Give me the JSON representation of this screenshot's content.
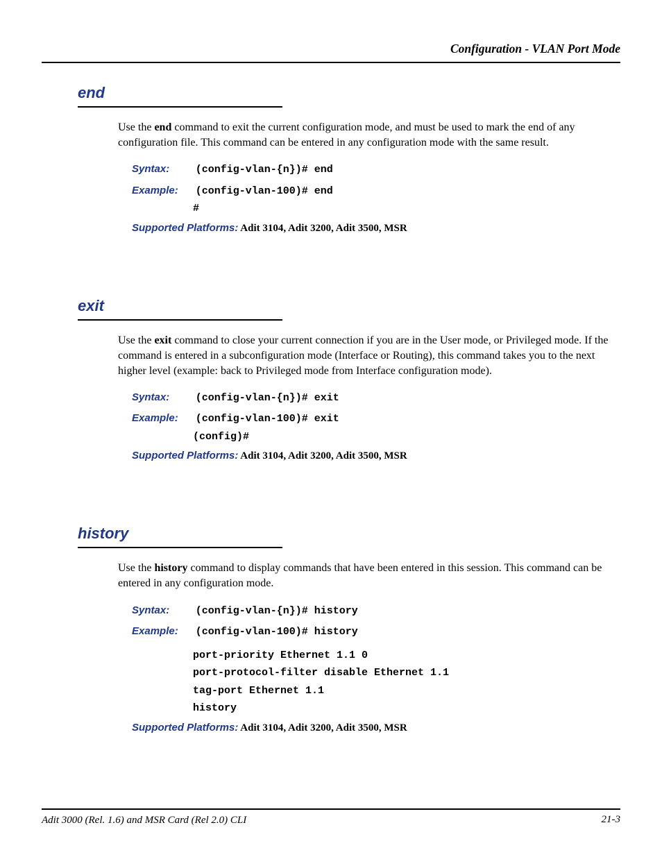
{
  "header": {
    "title": "Configuration - VLAN Port Mode"
  },
  "sections": {
    "end": {
      "heading": "end",
      "desc_pre": "Use the ",
      "desc_bold": "end",
      "desc_post": " command to exit the current configuration mode, and must be used to mark the end of any configuration file. This command can be entered in any configuration mode with the same result.",
      "syntax_label": "Syntax:",
      "syntax_code": "(config-vlan-{n})# end",
      "example_label": "Example:",
      "example_code": "(config-vlan-100)# end",
      "example_output": "#",
      "supported_label": "Supported Platforms:",
      "supported_text": "  Adit 3104, Adit 3200, Adit 3500, MSR"
    },
    "exit": {
      "heading": "exit",
      "desc_pre": "Use the ",
      "desc_bold": "exit",
      "desc_post": " command to close your current connection if you are in the User mode, or Privileged mode. If the command is entered in a subconfiguration mode (Interface or Routing), this command takes you to the next higher level (example: back to Privileged mode from Interface configuration mode).",
      "syntax_label": "Syntax:",
      "syntax_code": "(config-vlan-{n})# exit",
      "example_label": "Example:",
      "example_code": "(config-vlan-100)# exit",
      "example_output": "(config)#",
      "supported_label": "Supported Platforms:",
      "supported_text": "  Adit 3104, Adit 3200, Adit 3500, MSR"
    },
    "history": {
      "heading": "history",
      "desc_pre": "Use the ",
      "desc_bold": "history",
      "desc_post": " command to display commands that have been entered in this session.  This command can be entered in any configuration mode.",
      "syntax_label": "Syntax:",
      "syntax_code": "(config-vlan-{n})# history",
      "example_label": "Example:",
      "example_code": "(config-vlan-100)# history",
      "example_output": [
        "port-priority Ethernet 1.1 0",
        "port-protocol-filter disable Ethernet 1.1",
        "tag-port Ethernet 1.1",
        "history"
      ],
      "supported_label": "Supported Platforms:",
      "supported_text": "  Adit 3104, Adit 3200, Adit 3500, MSR"
    }
  },
  "footer": {
    "left": "Adit 3000 (Rel. 1.6) and MSR Card (Rel 2.0) CLI",
    "right": "21-3"
  }
}
